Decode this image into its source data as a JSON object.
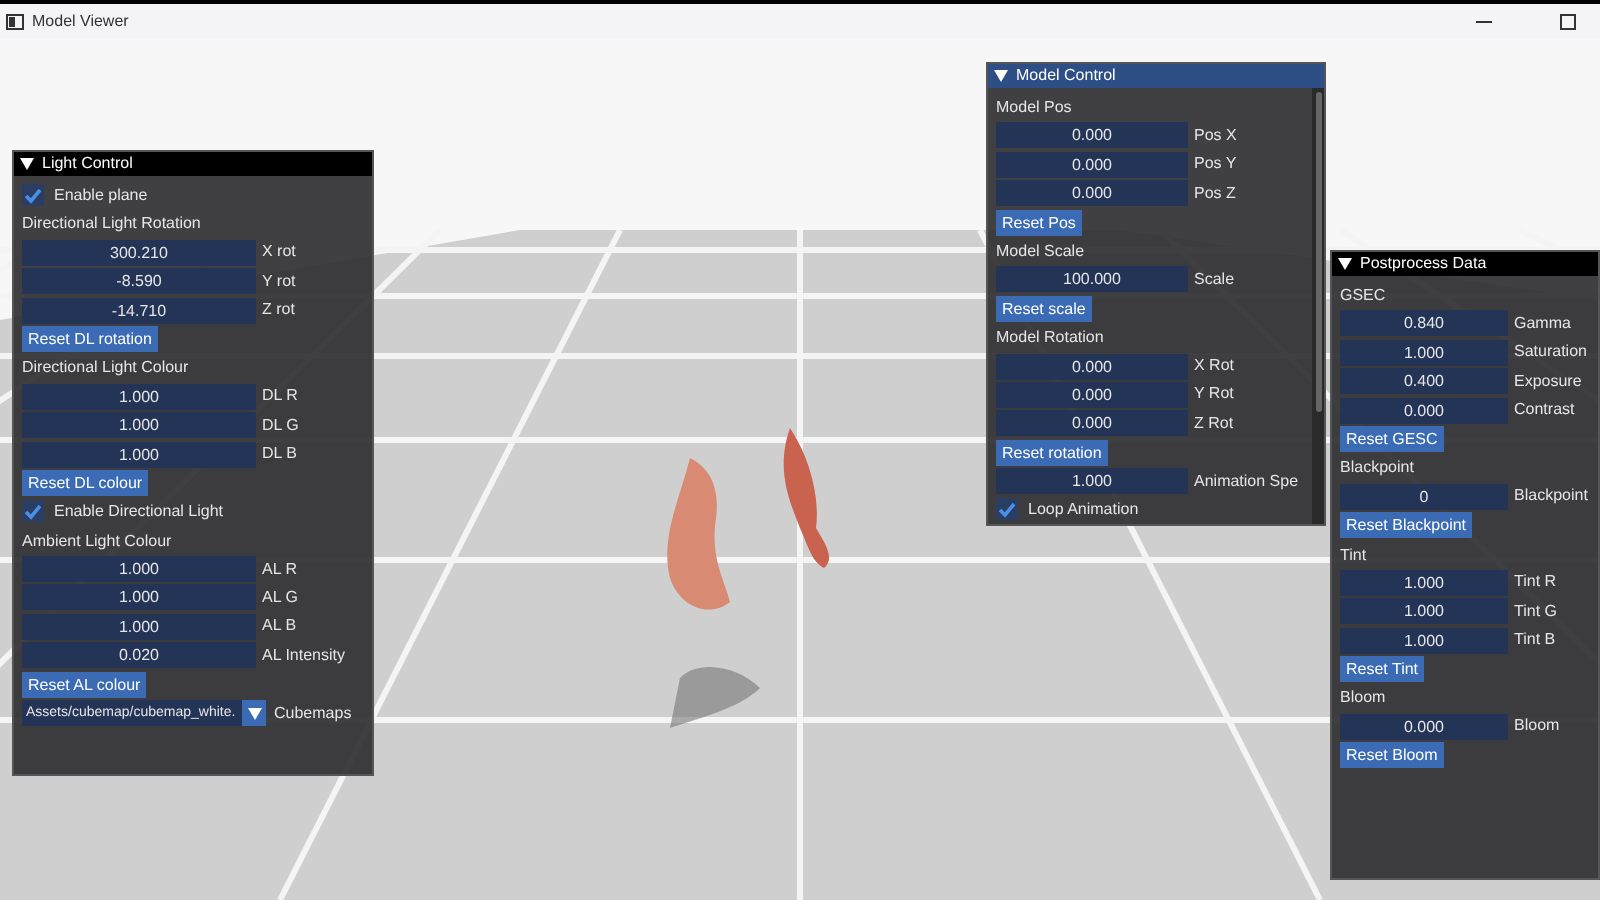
{
  "window": {
    "title": "Model Viewer"
  },
  "panels": [
    {
      "title": "Light Control",
      "focused": false,
      "items": [
        {
          "kind": "checkbox",
          "text": "Enable plane",
          "checked": true
        },
        {
          "kind": "heading",
          "heading": "Directional Light Rotation"
        },
        {
          "kind": "field",
          "value": "300.210",
          "label": "X rot"
        },
        {
          "kind": "field",
          "value": "-8.590",
          "label": "Y rot"
        },
        {
          "kind": "field",
          "value": "-14.710",
          "label": "Z rot"
        },
        {
          "kind": "button",
          "text": "Reset DL rotation"
        },
        {
          "kind": "heading",
          "heading": "Directional Light Colour"
        },
        {
          "kind": "field",
          "value": "1.000",
          "label": "DL R"
        },
        {
          "kind": "field",
          "value": "1.000",
          "label": "DL G"
        },
        {
          "kind": "field",
          "value": "1.000",
          "label": "DL B"
        },
        {
          "kind": "button",
          "text": "Reset DL colour"
        },
        {
          "kind": "checkbox",
          "text": "Enable Directional Light",
          "checked": true
        },
        {
          "kind": "heading",
          "heading": "Ambient Light Colour"
        },
        {
          "kind": "field",
          "value": "1.000",
          "label": "AL R"
        },
        {
          "kind": "field",
          "value": "1.000",
          "label": "AL G"
        },
        {
          "kind": "field",
          "value": "1.000",
          "label": "AL B"
        },
        {
          "kind": "field",
          "value": "0.020",
          "label": "AL Intensity"
        },
        {
          "kind": "button",
          "text": "Reset AL colour"
        },
        {
          "kind": "combo",
          "value": "Assets/cubemap/cubemap_white.",
          "label": "Cubemaps"
        }
      ]
    },
    {
      "title": "Model Control",
      "focused": true,
      "scrollable": true,
      "items": [
        {
          "kind": "heading",
          "heading": "Model Pos"
        },
        {
          "kind": "field",
          "value": "0.000",
          "label": "Pos X"
        },
        {
          "kind": "field",
          "value": "0.000",
          "label": "Pos Y"
        },
        {
          "kind": "field",
          "value": "0.000",
          "label": "Pos Z"
        },
        {
          "kind": "button",
          "text": "Reset Pos"
        },
        {
          "kind": "heading",
          "heading": "Model Scale"
        },
        {
          "kind": "field",
          "value": "100.000",
          "label": "Scale"
        },
        {
          "kind": "button",
          "text": "Reset scale"
        },
        {
          "kind": "heading",
          "heading": "Model Rotation"
        },
        {
          "kind": "field",
          "value": "0.000",
          "label": "X Rot"
        },
        {
          "kind": "field",
          "value": "0.000",
          "label": "Y Rot"
        },
        {
          "kind": "field",
          "value": "0.000",
          "label": "Z Rot"
        },
        {
          "kind": "button",
          "text": "Reset rotation"
        },
        {
          "kind": "field",
          "value": "1.000",
          "label": "Animation Spe"
        },
        {
          "kind": "checkbox",
          "text": "Loop Animation",
          "checked": true
        }
      ]
    },
    {
      "title": "Postprocess Data",
      "focused": false,
      "items": [
        {
          "kind": "heading",
          "heading": "GSEC"
        },
        {
          "kind": "field",
          "value": "0.840",
          "label": "Gamma"
        },
        {
          "kind": "field",
          "value": "1.000",
          "label": "Saturation"
        },
        {
          "kind": "field",
          "value": "0.400",
          "label": "Exposure"
        },
        {
          "kind": "field",
          "value": "0.000",
          "label": "Contrast"
        },
        {
          "kind": "button",
          "text": "Reset GESC"
        },
        {
          "kind": "heading",
          "heading": "Blackpoint"
        },
        {
          "kind": "field",
          "value": "0",
          "label": "Blackpoint"
        },
        {
          "kind": "button",
          "text": "Reset Blackpoint"
        },
        {
          "kind": "heading",
          "heading": "Tint"
        },
        {
          "kind": "field",
          "value": "1.000",
          "label": "Tint R"
        },
        {
          "kind": "field",
          "value": "1.000",
          "label": "Tint G"
        },
        {
          "kind": "field",
          "value": "1.000",
          "label": "Tint B"
        },
        {
          "kind": "button",
          "text": "Reset Tint"
        },
        {
          "kind": "heading",
          "heading": "Bloom"
        },
        {
          "kind": "field",
          "value": "0.000",
          "label": "Bloom"
        },
        {
          "kind": "button",
          "text": "Reset Bloom"
        }
      ]
    }
  ]
}
